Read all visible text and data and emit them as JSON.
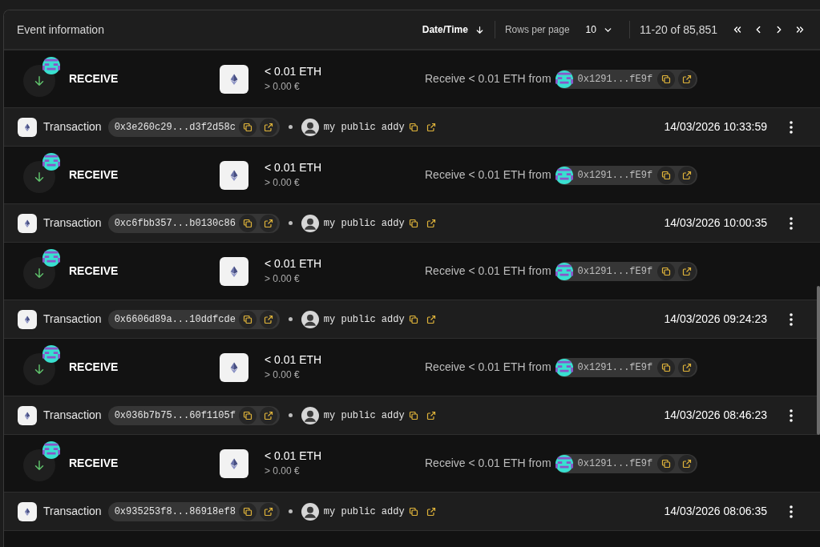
{
  "header": {
    "title": "Event information",
    "sort": {
      "label": "Date/Time",
      "descending": true
    },
    "rows_per_page": {
      "label": "Rows per page",
      "value": "10"
    },
    "range": "11-20 of 85,851"
  },
  "events": [
    {
      "kind": "receive",
      "label": "RECEIVE",
      "amount": "< 0.01 ETH",
      "fiat": "> 0.00 €",
      "description": "Receive < 0.01 ETH from",
      "counterparty": "0x1291...fE9f"
    },
    {
      "kind": "transaction",
      "label": "Transaction",
      "hash": "0x3e260c29...d3f2d58c",
      "account": "my public addy",
      "timestamp": "14/03/2026 10:33:59"
    },
    {
      "kind": "receive",
      "label": "RECEIVE",
      "amount": "< 0.01 ETH",
      "fiat": "> 0.00 €",
      "description": "Receive < 0.01 ETH from",
      "counterparty": "0x1291...fE9f"
    },
    {
      "kind": "transaction",
      "label": "Transaction",
      "hash": "0xc6fbb357...b0130c86",
      "account": "my public addy",
      "timestamp": "14/03/2026 10:00:35"
    },
    {
      "kind": "receive",
      "label": "RECEIVE",
      "amount": "< 0.01 ETH",
      "fiat": "> 0.00 €",
      "description": "Receive < 0.01 ETH from",
      "counterparty": "0x1291...fE9f"
    },
    {
      "kind": "transaction",
      "label": "Transaction",
      "hash": "0x6606d89a...10ddfcde",
      "account": "my public addy",
      "timestamp": "14/03/2026 09:24:23"
    },
    {
      "kind": "receive",
      "label": "RECEIVE",
      "amount": "< 0.01 ETH",
      "fiat": "> 0.00 €",
      "description": "Receive < 0.01 ETH from",
      "counterparty": "0x1291...fE9f"
    },
    {
      "kind": "transaction",
      "label": "Transaction",
      "hash": "0x036b7b75...60f1105f",
      "account": "my public addy",
      "timestamp": "14/03/2026 08:46:23"
    },
    {
      "kind": "receive",
      "label": "RECEIVE",
      "amount": "< 0.01 ETH",
      "fiat": "> 0.00 €",
      "description": "Receive < 0.01 ETH from",
      "counterparty": "0x1291...fE9f"
    },
    {
      "kind": "transaction",
      "label": "Transaction",
      "hash": "0x935253f8...86918ef8",
      "account": "my public addy",
      "timestamp": "14/03/2026 08:06:35"
    }
  ]
}
